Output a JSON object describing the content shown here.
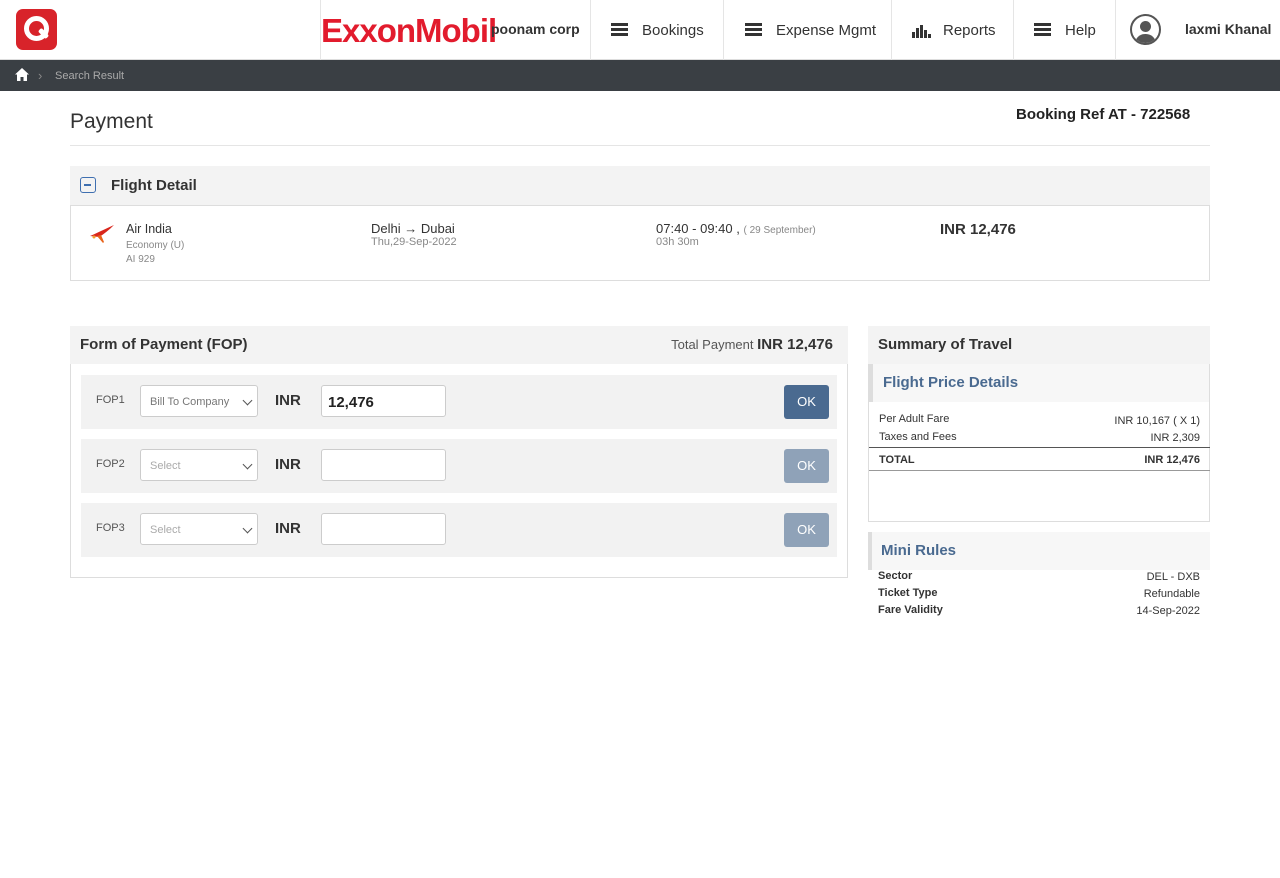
{
  "header": {
    "brand": "ExxonMobil",
    "corp": "poonam corp",
    "nav": [
      {
        "label": "Bookings",
        "icon": "menu-icon"
      },
      {
        "label": "Expense Mgmt",
        "icon": "menu-icon"
      },
      {
        "label": "Reports",
        "icon": "bar-chart-icon"
      },
      {
        "label": "Help",
        "icon": "menu-icon"
      }
    ],
    "user": "laxmi Khanal"
  },
  "breadcrumb": {
    "current": "Search Result"
  },
  "page": {
    "title": "Payment",
    "booking_ref": "Booking Ref AT - 722568"
  },
  "flight_detail": {
    "title": "Flight Detail",
    "airline": "Air India",
    "cabin": "Economy (U)",
    "flight_no": "AI 929",
    "route": "Delhi → Dubai",
    "date": "Thu,29-Sep-2022",
    "times": "07:40 - 09:40 ,",
    "times_note": "( 29 September)",
    "duration": "03h 30m",
    "price": "INR 12,476"
  },
  "fop": {
    "title": "Form of Payment (FOP)",
    "total_label": "Total Payment",
    "total_value": "INR 12,476",
    "rows": [
      {
        "label": "FOP1",
        "select": "Bill To Company",
        "currency": "INR",
        "amount": "12,476",
        "button": "OK"
      },
      {
        "label": "FOP2",
        "select": "Select",
        "currency": "INR",
        "amount": "",
        "button": "OK"
      },
      {
        "label": "FOP3",
        "select": "Select",
        "currency": "INR",
        "amount": "",
        "button": "OK"
      }
    ]
  },
  "summary": {
    "title": "Summary of Travel",
    "price_title": "Flight Price Details",
    "lines": [
      {
        "label": "Per Adult Fare",
        "value": "INR 10,167 ( X 1)"
      },
      {
        "label": "Taxes and Fees",
        "value": "INR 2,309"
      }
    ],
    "total_label": "TOTAL",
    "total_value": "INR 12,476",
    "rules_title": "Mini Rules",
    "rules": [
      {
        "label": "Sector",
        "value": "DEL - DXB"
      },
      {
        "label": "Ticket Type",
        "value": "Refundable"
      },
      {
        "label": "Fare Validity",
        "value": "14-Sep-2022"
      }
    ]
  },
  "colors": {
    "brand_red": "#e21b2d",
    "app_red": "#d8232a",
    "accent_blue": "#4a6a90",
    "topbar_dark": "#3a3f44"
  }
}
